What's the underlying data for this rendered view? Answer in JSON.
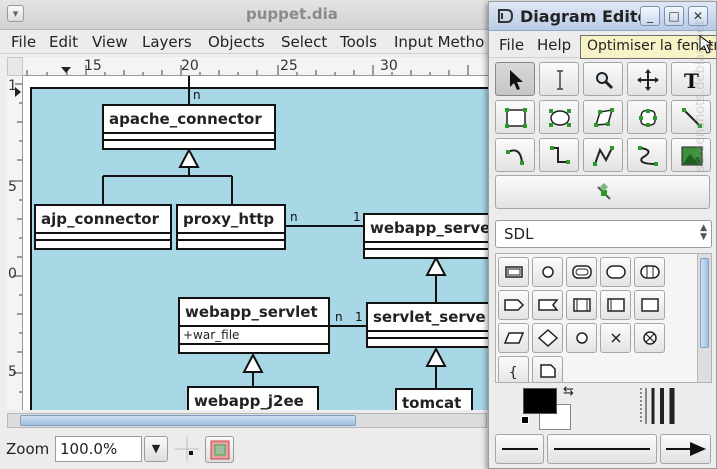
{
  "main_window": {
    "title": "puppet.dia",
    "menu": [
      "File",
      "Edit",
      "View",
      "Layers",
      "Objects",
      "Select",
      "Tools",
      "Input Metho"
    ],
    "ruler_h_labels": [
      "15",
      "20",
      "25",
      "30"
    ],
    "ruler_v_labels": [
      "1",
      "5",
      "0",
      "5"
    ],
    "zoom_label": "Zoom",
    "zoom_value": "100.0%"
  },
  "diagram": {
    "classes": {
      "apache_connector": "apache_connector",
      "ajp_connector": "ajp_connector",
      "proxy_http": "proxy_http",
      "webapp_server": "webapp_serve",
      "webapp_servlet": "webapp_servlet",
      "webapp_servlet_attr": "+war_file",
      "servlet_server": "servlet_serve",
      "webapp_j2ee": "webapp_j2ee",
      "tomcat": "tomcat"
    },
    "multiplicities": {
      "top_n": "n",
      "proxy_n": "n",
      "proxy_1": "1",
      "servlet_n": "n",
      "servlet_1": "1"
    }
  },
  "toolbox": {
    "title": "Diagram Edito",
    "menu": [
      "File",
      "Help"
    ],
    "tooltip": "Optimiser la fenêtre",
    "sheet": "SDL",
    "watermark": "screenshots.debian.net"
  },
  "colors": {
    "canvas_bg": "#a8d7e6",
    "foreground": "#000000",
    "background": "#ffffff"
  }
}
